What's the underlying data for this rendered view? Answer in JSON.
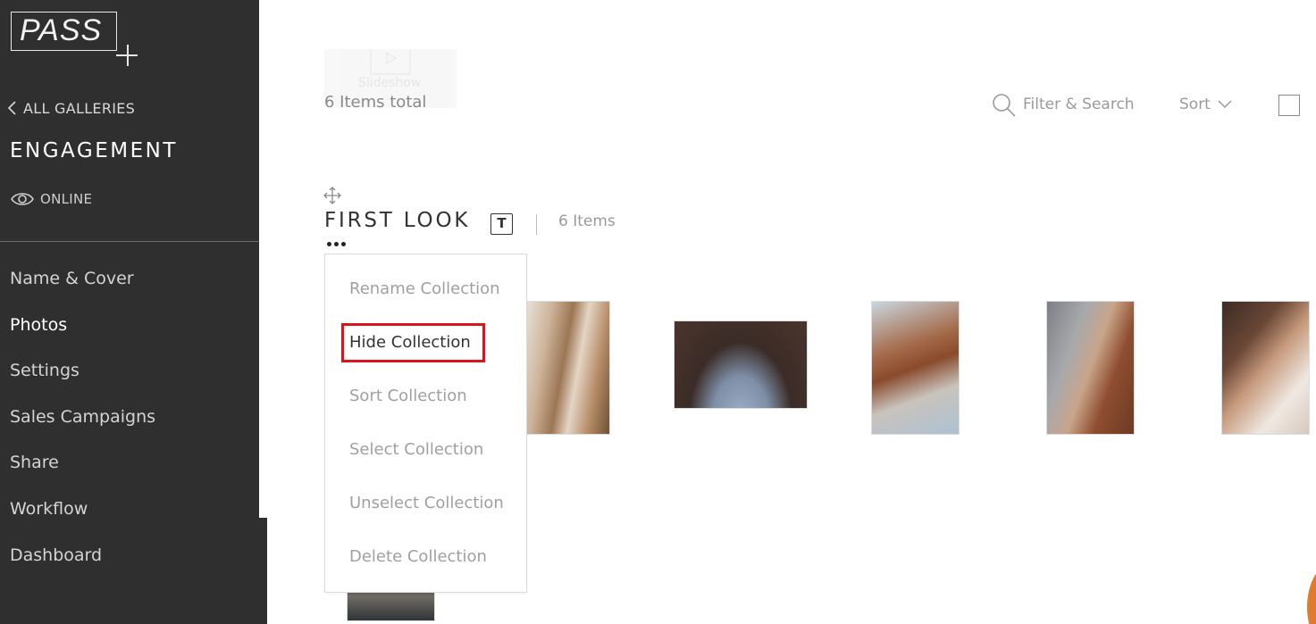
{
  "sidebar": {
    "logo_text": "PASS",
    "back_label": "ALL GALLERIES",
    "gallery_title": "ENGAGEMENT",
    "status_label": "ONLINE",
    "nav": [
      {
        "label": "Name & Cover",
        "active": false
      },
      {
        "label": "Photos",
        "active": true
      },
      {
        "label": "Settings",
        "active": false
      },
      {
        "label": "Sales Campaigns",
        "active": false
      },
      {
        "label": "Share",
        "active": false
      },
      {
        "label": "Workflow",
        "active": false
      },
      {
        "label": "Dashboard",
        "active": false
      }
    ]
  },
  "toolbar": {
    "slideshow_label": "Slideshow",
    "items_total": "6 Items total",
    "filter_label": "Filter & Search",
    "sort_label": "Sort"
  },
  "collection": {
    "title": "FIRST LOOK",
    "text_toggle": "T",
    "count": "6 Items"
  },
  "menu": {
    "items": [
      "Rename Collection",
      "Hide Collection",
      "Sort Collection",
      "Select Collection",
      "Unselect Collection",
      "Delete Collection"
    ]
  },
  "colors": {
    "sidebar_bg": "#2f2f2f",
    "highlight": "#d9151d",
    "accent": "#e07b2e"
  }
}
